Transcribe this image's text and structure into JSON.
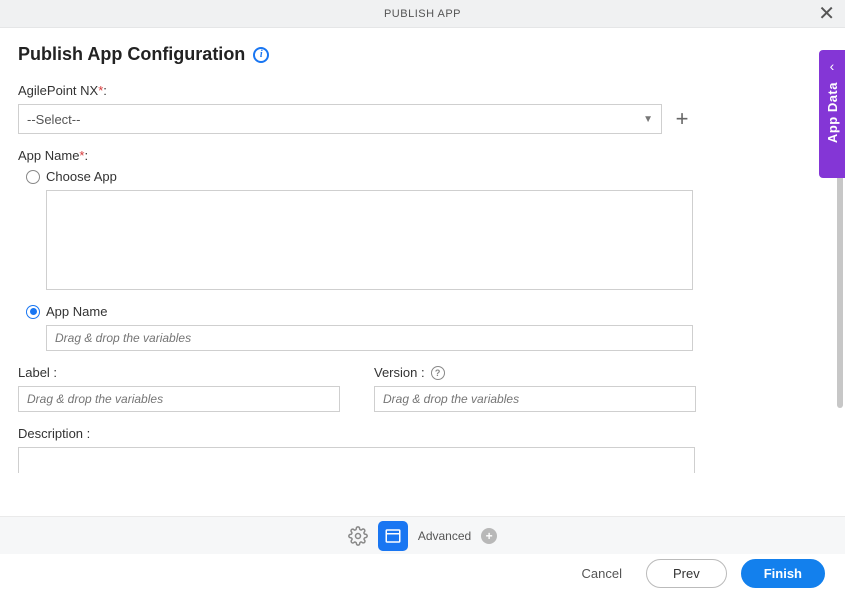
{
  "header": {
    "title": "PUBLISH APP"
  },
  "page": {
    "title": "Publish App Configuration"
  },
  "fields": {
    "agilepoint": {
      "label": "AgilePoint NX",
      "required_mark": "*",
      "colon": ":",
      "selected": "--Select--"
    },
    "app_name_section": {
      "label": "App Name",
      "required_mark": "*",
      "colon": ":",
      "choose_app_label": "Choose App",
      "app_name_label": "App Name",
      "app_name_placeholder": "Drag & drop the variables"
    },
    "label_field": {
      "label": "Label :",
      "placeholder": "Drag & drop the variables"
    },
    "version_field": {
      "label": "Version :",
      "placeholder": "Drag & drop the variables"
    },
    "description_field": {
      "label": "Description :"
    }
  },
  "side_panel": {
    "label": "App Data"
  },
  "footer": {
    "advanced_label": "Advanced",
    "cancel": "Cancel",
    "prev": "Prev",
    "finish": "Finish"
  }
}
